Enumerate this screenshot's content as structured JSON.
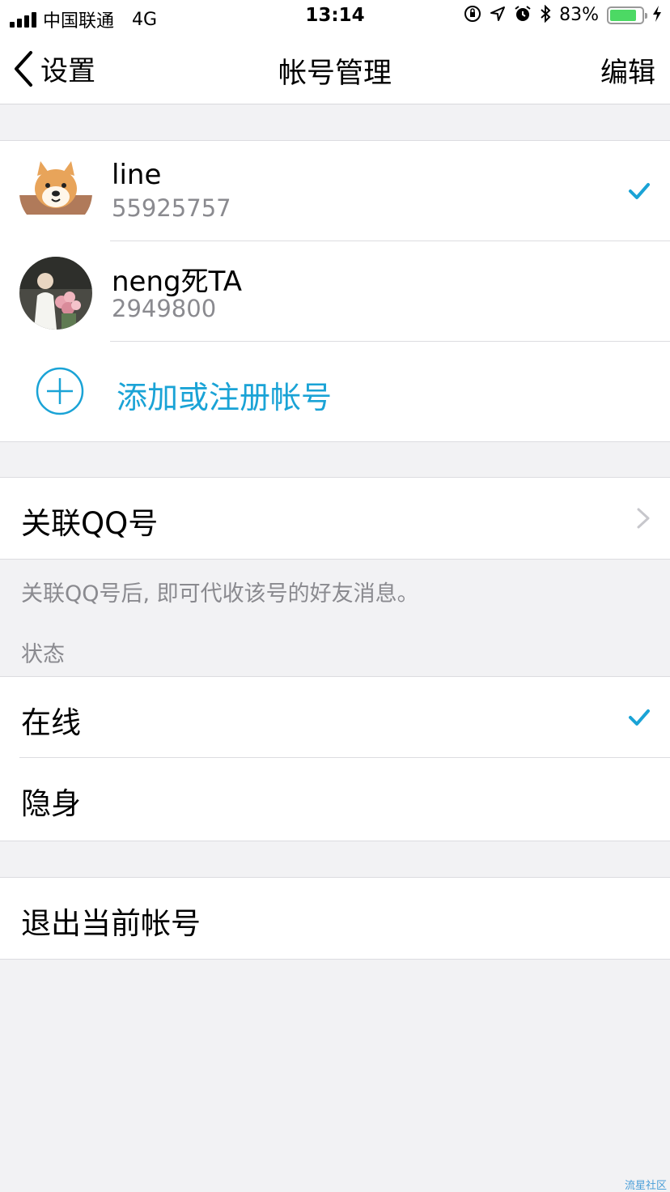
{
  "status_bar": {
    "carrier": "中国联通",
    "network": "4G",
    "time": "13:14",
    "battery": "83%",
    "battery_level": 0.83,
    "icons": [
      "orientation-lock-icon",
      "location-icon",
      "alarm-icon",
      "bluetooth-icon",
      "charging-icon"
    ]
  },
  "nav": {
    "back_label": "设置",
    "title": "帐号管理",
    "edit_label": "编辑"
  },
  "accounts": [
    {
      "name": "line",
      "id": "55925757",
      "selected": true
    },
    {
      "name": "neng死TA",
      "id": "2949800",
      "selected": false
    }
  ],
  "add_account": {
    "label": "添加或注册帐号"
  },
  "link_qq": {
    "label": "关联QQ号",
    "note": "关联QQ号后, 即可代收该号的好友消息。"
  },
  "status": {
    "section_title": "状态",
    "options": [
      {
        "label": "在线",
        "selected": true
      },
      {
        "label": "隐身",
        "selected": false
      }
    ]
  },
  "logout": {
    "label": "退出当前帐号"
  },
  "watermark": "流星社区",
  "colors": {
    "accent": "#1aa3d6",
    "background": "#f2f2f4",
    "battery": "#4cd964"
  }
}
